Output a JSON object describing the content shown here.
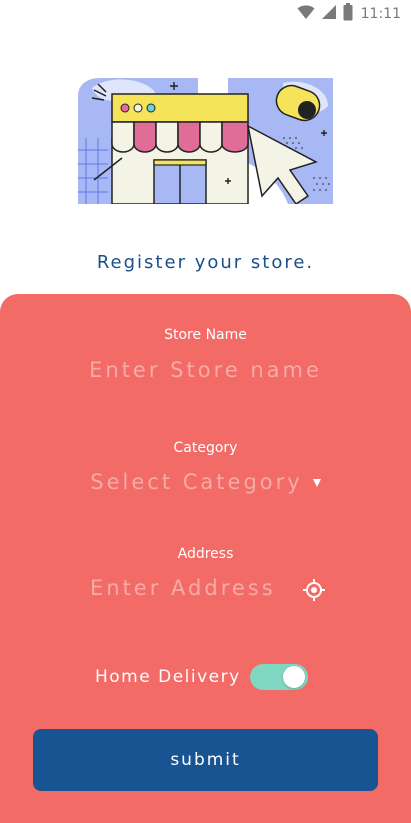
{
  "status_bar": {
    "time": "11:11",
    "icons": [
      "wifi-icon",
      "signal-icon",
      "battery-icon"
    ]
  },
  "illustration": {
    "icon": "storefront-illustration"
  },
  "heading": "Register your store.",
  "form": {
    "store_name": {
      "label": "Store Name",
      "placeholder": "Enter Store name"
    },
    "category": {
      "label": "Category",
      "placeholder": "Select Category",
      "icon": "dropdown-caret-icon"
    },
    "address": {
      "label": "Address",
      "placeholder": "Enter Address",
      "icon": "location-target-icon"
    },
    "home_delivery": {
      "label": "Home Delivery",
      "enabled": true
    },
    "submit_label": "submit"
  },
  "colors": {
    "card_background": "#f26b66",
    "heading": "#1a4f8b",
    "placeholder": "#f8aaa6",
    "button": "#185392",
    "toggle_on": "#7fd6c1"
  }
}
